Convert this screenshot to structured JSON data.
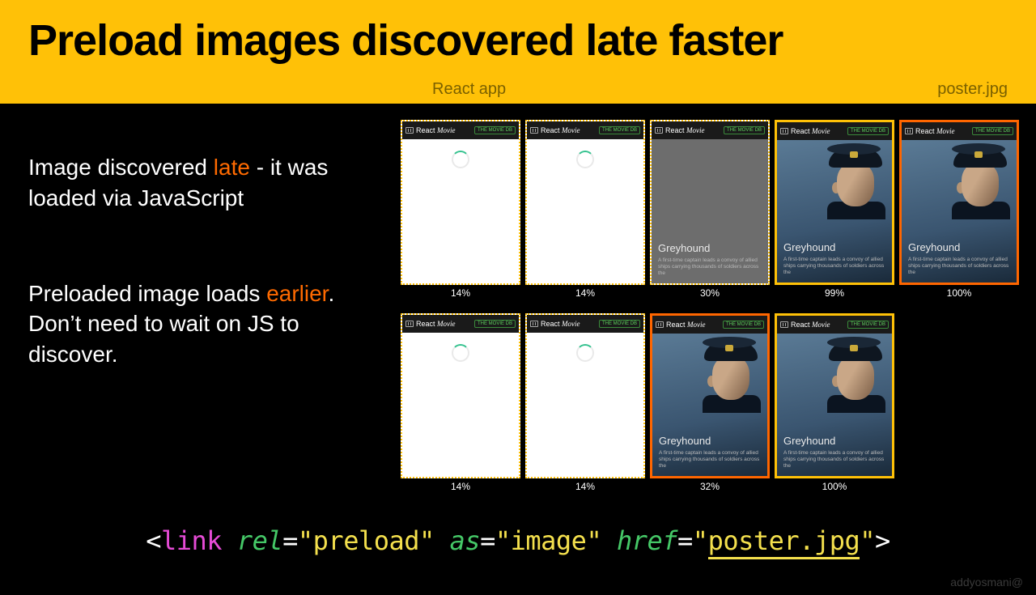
{
  "header": {
    "title": "Preload images discovered late faster",
    "sub_left": "React app",
    "sub_right": "poster.jpg"
  },
  "descriptions": {
    "row1_pre": "Image discovered ",
    "row1_hl": "late",
    "row1_post": " - it was loaded via JavaScript",
    "row2_pre": "Preloaded image loads ",
    "row2_hl": "earlier",
    "row2_post": ". Don’t need to wait on JS to discover."
  },
  "frame_bar": {
    "brand_prefix": "React ",
    "brand_suffix": "Movie",
    "badge": "THE MOVIE DB"
  },
  "poster": {
    "title": "Greyhound",
    "subtitle": "A first-time captain leads a convoy of allied ships carrying thousands of soldiers across the"
  },
  "rows": [
    {
      "frames": [
        {
          "state": "loading",
          "border": "dashed",
          "pct": "14%"
        },
        {
          "state": "loading",
          "border": "dashed",
          "pct": "14%"
        },
        {
          "state": "placeholder",
          "border": "dashed",
          "pct": "30%"
        },
        {
          "state": "poster",
          "border": "solid-yellow",
          "pct": "99%"
        },
        {
          "state": "poster",
          "border": "solid-orange",
          "pct": "100%"
        }
      ]
    },
    {
      "frames": [
        {
          "state": "loading",
          "border": "dashed",
          "pct": "14%"
        },
        {
          "state": "loading",
          "border": "dashed",
          "pct": "14%"
        },
        {
          "state": "poster",
          "border": "solid-orange",
          "pct": "32%"
        },
        {
          "state": "poster",
          "border": "solid-yellow",
          "pct": "100%"
        }
      ]
    }
  ],
  "code": {
    "lt": "<",
    "tag": "link",
    "attr_rel": "rel",
    "val_rel": "\"preload\"",
    "attr_as": "as",
    "val_as": "\"image\"",
    "attr_href": "href",
    "val_href_open": "\"",
    "val_href_text": "poster.jpg",
    "val_href_close": "\"",
    "gt": ">"
  },
  "credit": "addyosmani@"
}
